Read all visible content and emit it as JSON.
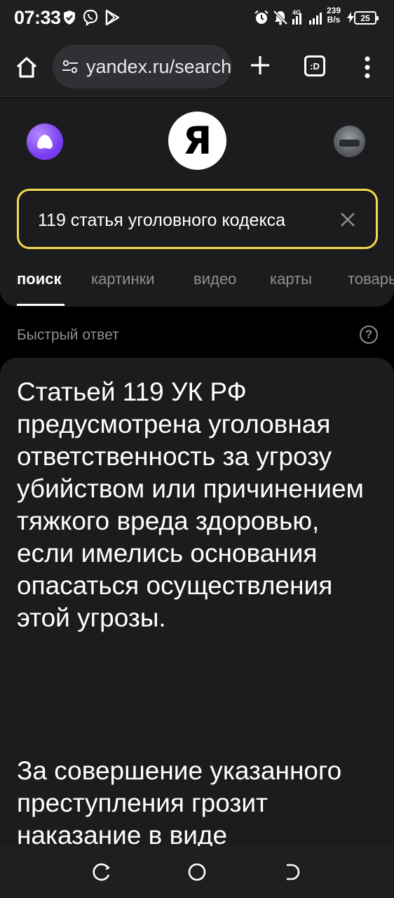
{
  "status_bar": {
    "time": "07:33",
    "net_speed_value": "239",
    "net_speed_unit": "B/s",
    "network_type": "4G",
    "battery": "25",
    "icons": [
      "shield-icon",
      "viber-icon",
      "play-icon",
      "alarm-icon",
      "mute-icon",
      "signal-icon",
      "charging-icon"
    ]
  },
  "browser": {
    "url": "yandex.ru/search",
    "tab_count_label": ":D"
  },
  "yandex": {
    "logo_letter": "Я",
    "search_query": "119 статья уголовного кодекса",
    "tabs": [
      "поиск",
      "картинки",
      "видео",
      "карты",
      "товары"
    ],
    "active_tab": "поиск"
  },
  "quick_answer": {
    "label": "Быстрый ответ",
    "help": "?",
    "paragraph_1": "Статьей 119 УК РФ предусмотрена уголовная ответственность за угрозу убийством или причинением тяжкого вреда здоровью, если имелись основания опасаться осуществления этой угрозы.",
    "paragraph_2": "За совершение указанного преступления грозит наказание в виде"
  },
  "colors": {
    "accent_search_border": "#f5d94c",
    "alice_purple": "#7b3ff2",
    "panel_bg": "#1c1c1e",
    "page_bg": "#000000",
    "muted_text": "#8e8e93"
  }
}
